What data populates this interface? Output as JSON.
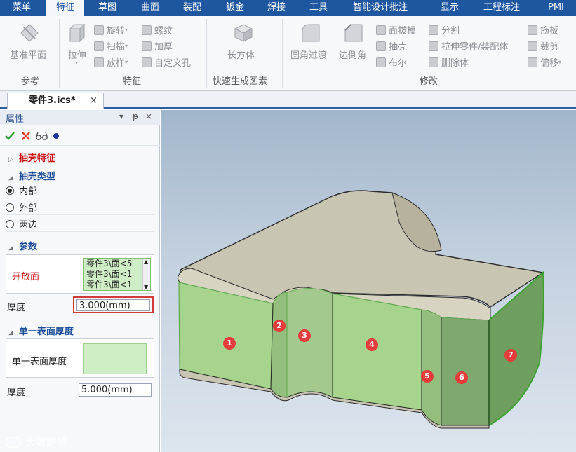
{
  "menu": {
    "items": [
      "菜单",
      "特征",
      "草图",
      "曲面",
      "装配",
      "钣金",
      "焊接",
      "工具",
      "智能设计批注",
      "显示",
      "工程标注",
      "PMI"
    ],
    "active": "特征"
  },
  "ribbon": {
    "ref_group": {
      "plane_label": "基准平面",
      "group_label": "参考"
    },
    "feature_group": {
      "extrude_label": "拉伸",
      "revolve_label": "旋转",
      "sweep_label": "扫描",
      "loft_label": "放样",
      "thread_label": "螺纹",
      "thicken_label": "加厚",
      "custom_hole_label": "自定义孔",
      "group_label": "特征"
    },
    "quick_group": {
      "block_label": "长方体",
      "group_label": "快速生成图素"
    },
    "modify_group": {
      "fillet_label": "圆角过渡",
      "chamfer_label": "边倒角",
      "draft_label": "面拔模",
      "shell_label": "抽壳",
      "boolean_label": "布尔",
      "split_label": "分割",
      "extrude_part_label": "拉伸零件/装配体",
      "delete_body_label": "删除体",
      "rib_label": "筋板",
      "trim_label": "裁剪",
      "offset_label": "偏移",
      "group_label": "修改"
    }
  },
  "doc_tab": {
    "name": "零件3.ics*",
    "close": "×"
  },
  "panel": {
    "title": "属性",
    "controls": {
      "menu": "▾",
      "pin": "ᵽ",
      "close": "×"
    },
    "shell_feature_label": "抽壳特征",
    "shell_type_label": "抽壳类型",
    "shell_types": [
      "内部",
      "外部",
      "两边"
    ],
    "selected_type": "内部",
    "params_label": "参数",
    "open_face_label": "开放面",
    "open_faces": [
      "零件3\\面<5",
      "零件3\\面<1",
      "零件3\\面<1"
    ],
    "thickness_label": "厚度",
    "thickness_value": "3.000(mm)",
    "single_surface_section": "单一表面厚度",
    "single_surface_label": "单一表面厚度",
    "single_thickness_label": "厚度",
    "single_thickness_value": "5.000(mm)"
  },
  "viewport": {
    "markers": [
      "1",
      "2",
      "3",
      "4",
      "5",
      "6",
      "7"
    ],
    "watermark": "大数跨境"
  },
  "colors": {
    "menubar": "#1e56a0",
    "panel_title": "#2a4f8a",
    "section_red": "#cc1111",
    "section_blue": "#1f4f99",
    "highlight_green": "#8fd07f",
    "marker_red": "#e43b3b",
    "field_highlight": "#d33a3a"
  }
}
